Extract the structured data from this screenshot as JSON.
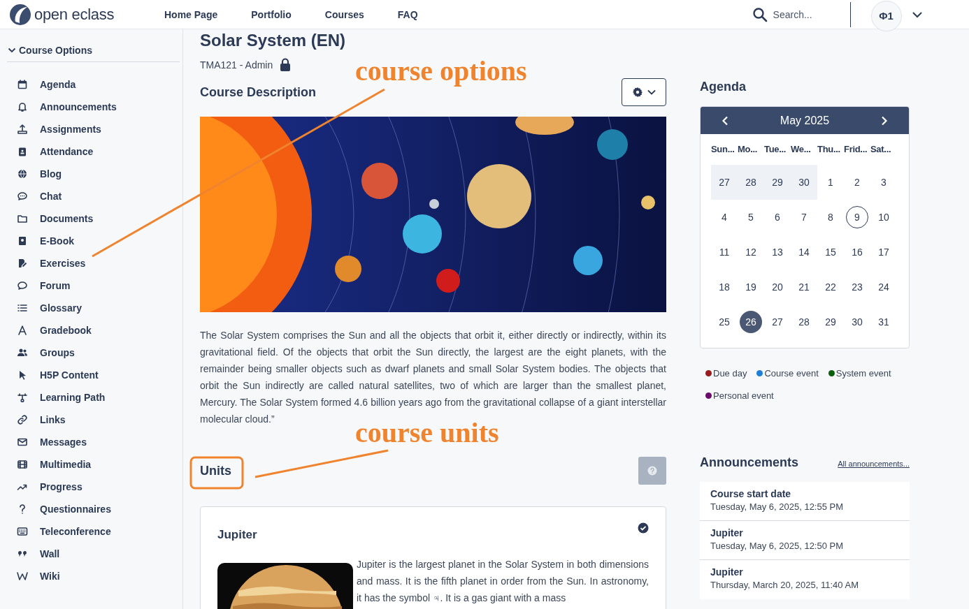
{
  "header": {
    "logo_text": "open eclass",
    "nav": [
      {
        "label": "Home Page"
      },
      {
        "label": "Portfolio"
      },
      {
        "label": "Courses"
      },
      {
        "label": "FAQ"
      }
    ],
    "search": {
      "placeholder": "Search..."
    },
    "user_badge": "Φ1"
  },
  "sidebar": {
    "heading": "Course Options",
    "expanded": true,
    "items": [
      {
        "label": "Agenda"
      },
      {
        "label": "Announcements"
      },
      {
        "label": "Assignments"
      },
      {
        "label": "Attendance"
      },
      {
        "label": "Blog"
      },
      {
        "label": "Chat"
      },
      {
        "label": "Documents"
      },
      {
        "label": "E-Book"
      },
      {
        "label": "Exercises"
      },
      {
        "label": "Forum"
      },
      {
        "label": "Glossary"
      },
      {
        "label": "Gradebook"
      },
      {
        "label": "Groups"
      },
      {
        "label": "H5P Content"
      },
      {
        "label": "Learning Path"
      },
      {
        "label": "Links"
      },
      {
        "label": "Messages"
      },
      {
        "label": "Multimedia"
      },
      {
        "label": "Progress"
      },
      {
        "label": "Questionnaires"
      },
      {
        "label": "Teleconference"
      },
      {
        "label": "Wall"
      },
      {
        "label": "Wiki"
      }
    ]
  },
  "course": {
    "title": "Solar System (EN)",
    "code": "TMA121 - Admin",
    "locked": true,
    "description_heading": "Course Description",
    "description": "The Solar System comprises the Sun and all the objects that orbit it, either directly or indirectly, within its gravitational field. Of the objects that orbit the Sun directly, the largest are the eight planets, with the remainder being smaller objects such as dwarf planets and small Solar System bodies. The objects that orbit the Sun indirectly are called natural satellites, two of which are larger than the smallest planet, Mercury. The Solar System formed 4.6 billion years ago from the gravitational collapse of a giant interstellar molecular cloud.”",
    "units_heading": "Units",
    "units": [
      {
        "title": "Jupiter",
        "completed": true,
        "text": "Jupiter is the largest planet in the Solar System in both dimensions and mass. It is the fifth planet in order from the Sun. In astronomy, it has the symbol ♃. It is a gas giant with a mass"
      }
    ]
  },
  "annotations": [
    {
      "text": "course options"
    },
    {
      "text": "course units"
    }
  ],
  "agenda": {
    "heading": "Agenda",
    "month": "May 2025",
    "weekdays": [
      "Sun...",
      "Mo...",
      "Tue...",
      "We...",
      "Thu...",
      "Frid...",
      "Sat..."
    ],
    "weeks": [
      [
        {
          "day": "27",
          "muted": true,
          "selected": false,
          "circled": false
        },
        {
          "day": "28",
          "muted": true,
          "selected": false,
          "circled": false
        },
        {
          "day": "29",
          "muted": true,
          "selected": false,
          "circled": false
        },
        {
          "day": "30",
          "muted": true,
          "selected": false,
          "circled": false
        },
        {
          "day": "1",
          "muted": false,
          "selected": false,
          "circled": false
        },
        {
          "day": "2",
          "muted": false,
          "selected": false,
          "circled": false
        },
        {
          "day": "3",
          "muted": false,
          "selected": false,
          "circled": false
        }
      ],
      [
        {
          "day": "4",
          "muted": false,
          "selected": false,
          "circled": false
        },
        {
          "day": "5",
          "muted": false,
          "selected": false,
          "circled": false
        },
        {
          "day": "6",
          "muted": false,
          "selected": false,
          "circled": false
        },
        {
          "day": "7",
          "muted": false,
          "selected": false,
          "circled": false
        },
        {
          "day": "8",
          "muted": false,
          "selected": false,
          "circled": false
        },
        {
          "day": "9",
          "muted": false,
          "selected": false,
          "circled": true
        },
        {
          "day": "10",
          "muted": false,
          "selected": false,
          "circled": false
        }
      ],
      [
        {
          "day": "11",
          "muted": false,
          "selected": false,
          "circled": false
        },
        {
          "day": "12",
          "muted": false,
          "selected": false,
          "circled": false
        },
        {
          "day": "13",
          "muted": false,
          "selected": false,
          "circled": false
        },
        {
          "day": "14",
          "muted": false,
          "selected": false,
          "circled": false
        },
        {
          "day": "15",
          "muted": false,
          "selected": false,
          "circled": false
        },
        {
          "day": "16",
          "muted": false,
          "selected": false,
          "circled": false
        },
        {
          "day": "17",
          "muted": false,
          "selected": false,
          "circled": false
        }
      ],
      [
        {
          "day": "18",
          "muted": false,
          "selected": false,
          "circled": false
        },
        {
          "day": "19",
          "muted": false,
          "selected": false,
          "circled": false
        },
        {
          "day": "20",
          "muted": false,
          "selected": false,
          "circled": false
        },
        {
          "day": "21",
          "muted": false,
          "selected": false,
          "circled": false
        },
        {
          "day": "22",
          "muted": false,
          "selected": false,
          "circled": false
        },
        {
          "day": "23",
          "muted": false,
          "selected": false,
          "circled": false
        },
        {
          "day": "24",
          "muted": false,
          "selected": false,
          "circled": false
        }
      ],
      [
        {
          "day": "25",
          "muted": false,
          "selected": false,
          "circled": false
        },
        {
          "day": "26",
          "muted": false,
          "selected": true,
          "circled": false
        },
        {
          "day": "27",
          "muted": false,
          "selected": false,
          "circled": false
        },
        {
          "day": "28",
          "muted": false,
          "selected": false,
          "circled": false
        },
        {
          "day": "29",
          "muted": false,
          "selected": false,
          "circled": false
        },
        {
          "day": "30",
          "muted": false,
          "selected": false,
          "circled": false
        },
        {
          "day": "31",
          "muted": false,
          "selected": false,
          "circled": false
        }
      ]
    ],
    "legend": [
      {
        "label": "Due day",
        "color": "#9b1c1c"
      },
      {
        "label": "Course event",
        "color": "#1e7fd8"
      },
      {
        "label": "System event",
        "color": "#0b5e0b"
      },
      {
        "label": "Personal event",
        "color": "#6b0b6b"
      }
    ]
  },
  "announcements": {
    "heading": "Announcements",
    "all_link": "All announcements...",
    "items": [
      {
        "title": "Course start date",
        "date": "Tuesday, May 6, 2025, 12:55 PM"
      },
      {
        "title": "Jupiter",
        "date": "Tuesday, May 6, 2025, 12:50 PM"
      },
      {
        "title": "Jupiter",
        "date": "Thursday, March 20, 2025, 11:40 AM"
      }
    ]
  }
}
